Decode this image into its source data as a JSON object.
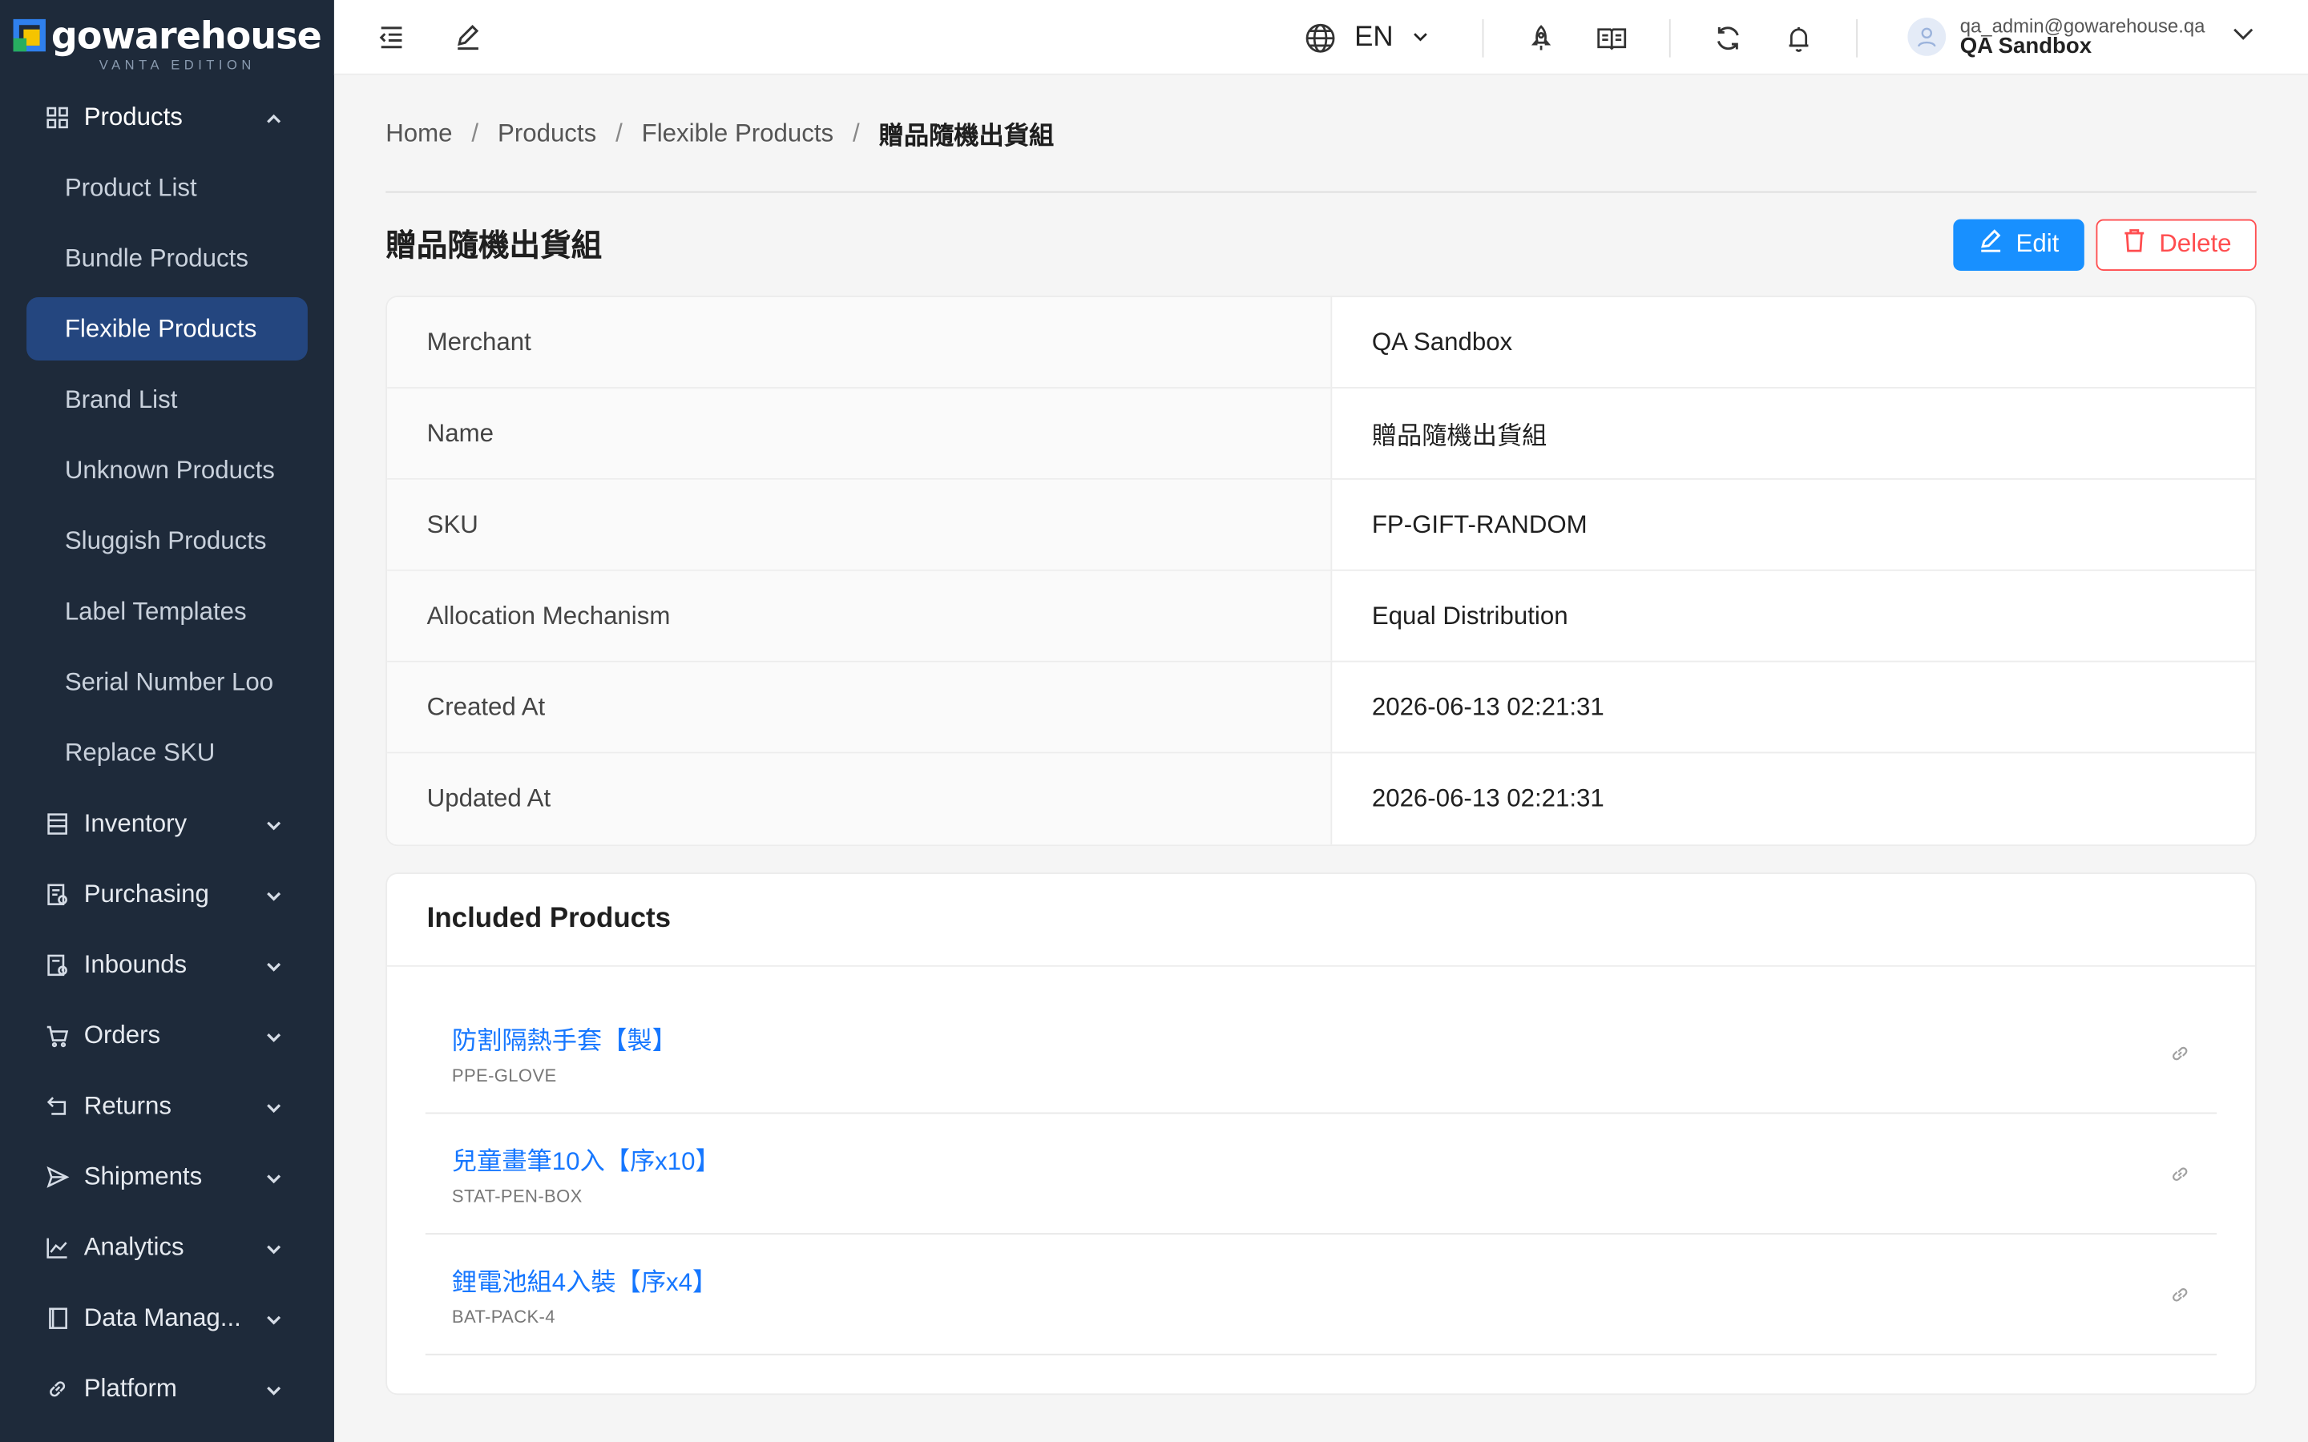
{
  "logo": {
    "name": "gowarehouse",
    "edition": "VANTA EDITION"
  },
  "sidebar": {
    "products_group": {
      "label": "Products",
      "icon": "grid-icon"
    },
    "product_items": [
      {
        "label": "Product List",
        "active": false
      },
      {
        "label": "Bundle Products",
        "active": false
      },
      {
        "label": "Flexible Products",
        "active": true
      },
      {
        "label": "Brand List",
        "active": false
      },
      {
        "label": "Unknown Products",
        "active": false
      },
      {
        "label": "Sluggish Products",
        "active": false
      },
      {
        "label": "Label Templates",
        "active": false
      },
      {
        "label": "Serial Number Loo",
        "active": false
      },
      {
        "label": "Replace SKU",
        "active": false
      }
    ],
    "groups": [
      {
        "label": "Inventory",
        "icon": "inventory-icon"
      },
      {
        "label": "Purchasing",
        "icon": "purchasing-icon"
      },
      {
        "label": "Inbounds",
        "icon": "inbounds-icon"
      },
      {
        "label": "Orders",
        "icon": "cart-icon"
      },
      {
        "label": "Returns",
        "icon": "return-icon"
      },
      {
        "label": "Shipments",
        "icon": "send-icon"
      },
      {
        "label": "Analytics",
        "icon": "line-chart-icon"
      },
      {
        "label": "Data Manag...",
        "icon": "book-icon"
      },
      {
        "label": "Platform",
        "icon": "link-icon"
      }
    ]
  },
  "topbar": {
    "language": "EN",
    "user_email": "qa_admin@gowarehouse.qa",
    "user_name": "QA Sandbox"
  },
  "breadcrumb": [
    "Home",
    "Products",
    "Flexible Products",
    "贈品隨機出貨組"
  ],
  "page": {
    "title": "贈品隨機出貨組",
    "edit_label": "Edit",
    "delete_label": "Delete"
  },
  "details": [
    {
      "label": "Merchant",
      "value": "QA Sandbox"
    },
    {
      "label": "Name",
      "value": "贈品隨機出貨組"
    },
    {
      "label": "SKU",
      "value": "FP-GIFT-RANDOM"
    },
    {
      "label": "Allocation Mechanism",
      "value": "Equal Distribution"
    },
    {
      "label": "Created At",
      "value": "2026-06-13 02:21:31"
    },
    {
      "label": "Updated At",
      "value": "2026-06-13 02:21:31"
    }
  ],
  "included": {
    "title": "Included Products",
    "items": [
      {
        "name": "防割隔熱手套【製】",
        "sku": "PPE-GLOVE"
      },
      {
        "name": "兒童畫筆10入【序x10】",
        "sku": "STAT-PEN-BOX"
      },
      {
        "name": "鋰電池組4入裝【序x4】",
        "sku": "BAT-PACK-4"
      }
    ]
  },
  "colors": {
    "sidebar_bg": "#1e2a3a",
    "active_bg": "#24467f",
    "primary": "#1890ff",
    "danger": "#ff4d4f",
    "link": "#1677ff"
  }
}
